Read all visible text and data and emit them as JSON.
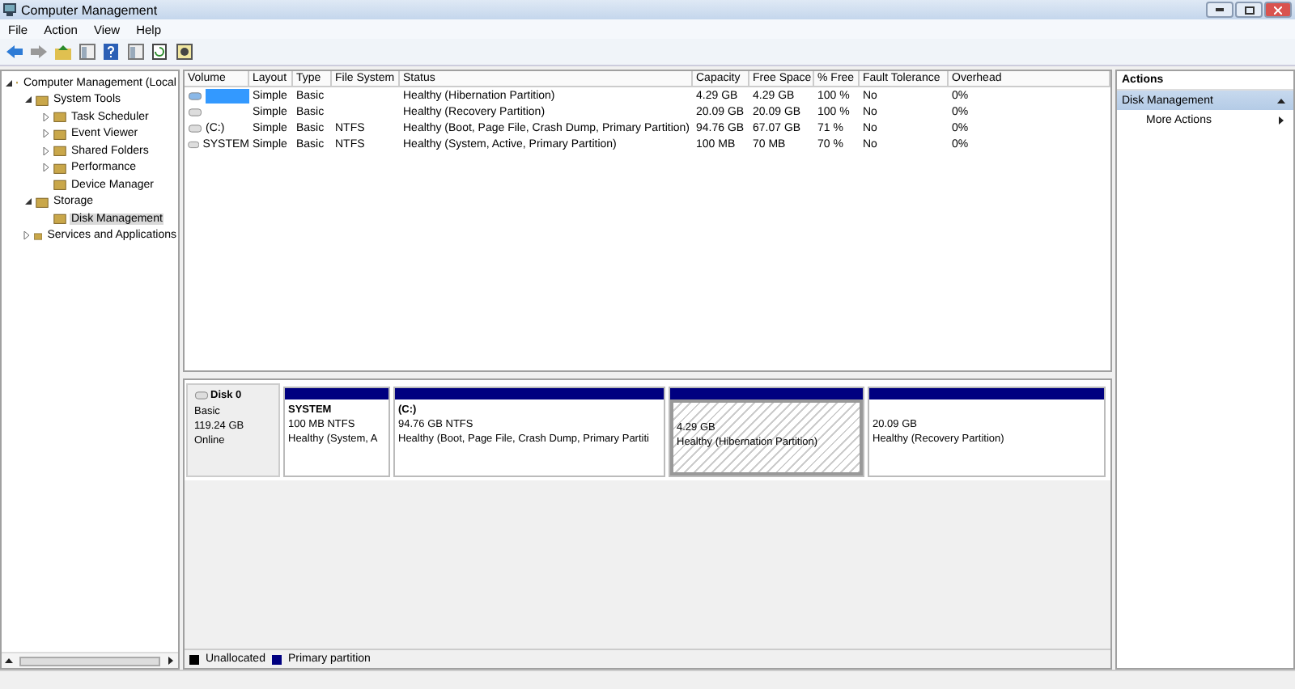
{
  "window": {
    "title": "Computer Management"
  },
  "menu": [
    "File",
    "Action",
    "View",
    "Help"
  ],
  "tree": [
    {
      "label": "Computer Management (Local",
      "expanded": true,
      "selected": false,
      "children": [
        {
          "label": "System Tools",
          "expanded": true,
          "selected": false,
          "children": [
            {
              "label": "Task Scheduler",
              "expanded": false,
              "selected": false
            },
            {
              "label": "Event Viewer",
              "expanded": false,
              "selected": false
            },
            {
              "label": "Shared Folders",
              "expanded": false,
              "selected": false
            },
            {
              "label": "Performance",
              "expanded": false,
              "selected": false
            },
            {
              "label": "Device Manager",
              "selected": false
            }
          ]
        },
        {
          "label": "Storage",
          "expanded": true,
          "selected": false,
          "children": [
            {
              "label": "Disk Management",
              "selected": true
            }
          ]
        },
        {
          "label": "Services and Applications",
          "expanded": false,
          "selected": false
        }
      ]
    }
  ],
  "volumes": {
    "columns": [
      "Volume",
      "Layout",
      "Type",
      "File System",
      "Status",
      "Capacity",
      "Free Space",
      "% Free",
      "Fault Tolerance",
      "Overhead"
    ],
    "rows": [
      {
        "selected": true,
        "cells": [
          "",
          "Simple",
          "Basic",
          "",
          "Healthy (Hibernation Partition)",
          "4.29 GB",
          "4.29 GB",
          "100 %",
          "No",
          "0%"
        ]
      },
      {
        "selected": false,
        "cells": [
          "",
          "Simple",
          "Basic",
          "",
          "Healthy (Recovery Partition)",
          "20.09 GB",
          "20.09 GB",
          "100 %",
          "No",
          "0%"
        ]
      },
      {
        "selected": false,
        "cells": [
          "(C:)",
          "Simple",
          "Basic",
          "NTFS",
          "Healthy (Boot, Page File, Crash Dump, Primary Partition)",
          "94.76 GB",
          "67.07 GB",
          "71 %",
          "No",
          "0%"
        ]
      },
      {
        "selected": false,
        "cells": [
          "SYSTEM",
          "Simple",
          "Basic",
          "NTFS",
          "Healthy (System, Active, Primary Partition)",
          "100 MB",
          "70 MB",
          "70 %",
          "No",
          "0%"
        ]
      }
    ]
  },
  "disk": {
    "name": "Disk 0",
    "type": "Basic",
    "size": "119.24 GB",
    "status": "Online",
    "partitions": [
      {
        "name": "SYSTEM",
        "size": "100 MB NTFS",
        "status": "Healthy (System, A",
        "selected": false
      },
      {
        "name": "(C:)",
        "size": "94.76 GB NTFS",
        "status": "Healthy (Boot, Page File, Crash Dump, Primary Partiti",
        "selected": false
      },
      {
        "size": "4.29 GB",
        "status": "Healthy (Hibernation Partition)",
        "selected": true
      },
      {
        "size": "20.09 GB",
        "status": "Healthy (Recovery Partition)",
        "selected": false
      }
    ]
  },
  "legend": [
    {
      "label": "Unallocated",
      "color": "#000000"
    },
    {
      "label": "Primary partition",
      "color": "#000080"
    }
  ],
  "actions": {
    "title": "Actions",
    "section": "Disk Management",
    "items": [
      "More Actions"
    ]
  }
}
